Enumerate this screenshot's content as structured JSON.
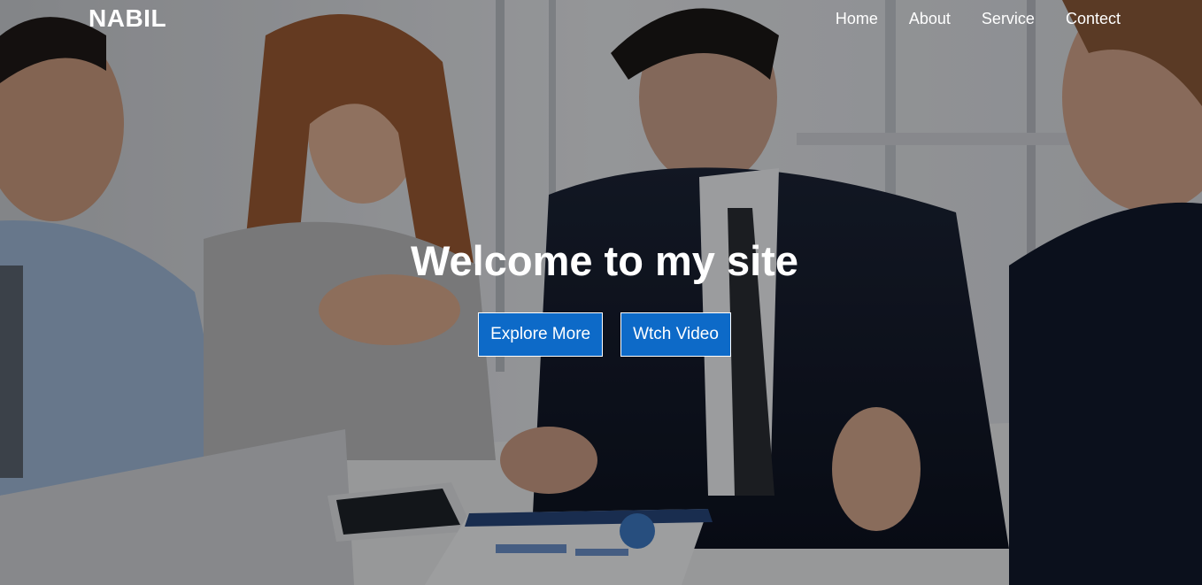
{
  "brand": {
    "name": "NABIL"
  },
  "nav": {
    "items": [
      {
        "label": "Home"
      },
      {
        "label": "About"
      },
      {
        "label": "Service"
      },
      {
        "label": "Contect"
      }
    ]
  },
  "hero": {
    "title": "Welcome to my site",
    "buttons": [
      {
        "label": "Explore More"
      },
      {
        "label": "Wtch Video"
      }
    ]
  },
  "colors": {
    "button_bg": "#0d6ac8",
    "text": "#ffffff"
  }
}
